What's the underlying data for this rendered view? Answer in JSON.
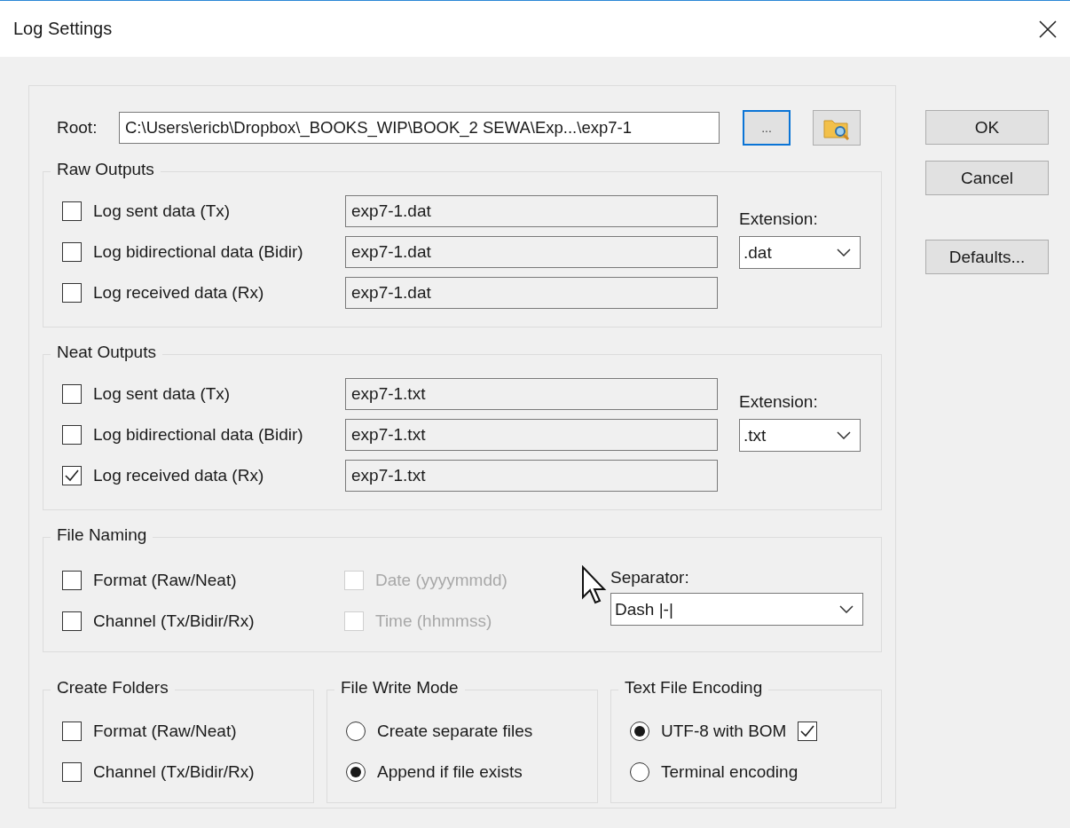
{
  "window": {
    "title": "Log Settings"
  },
  "root": {
    "label": "Root:",
    "value": "C:\\Users\\ericb\\Dropbox\\_BOOKS_WIP\\BOOK_2 SEWA\\Exp...\\exp7-1",
    "browse_button": "..."
  },
  "raw_outputs": {
    "title": "Raw Outputs",
    "extension_label": "Extension:",
    "extension": ".dat",
    "rows": [
      {
        "label": "Log sent data (Tx)",
        "checked": false,
        "value": "exp7-1.dat"
      },
      {
        "label": "Log bidirectional data (Bidir)",
        "checked": false,
        "value": "exp7-1.dat"
      },
      {
        "label": "Log received data (Rx)",
        "checked": false,
        "value": "exp7-1.dat"
      }
    ]
  },
  "neat_outputs": {
    "title": "Neat Outputs",
    "extension_label": "Extension:",
    "extension": ".txt",
    "rows": [
      {
        "label": "Log sent data (Tx)",
        "checked": false,
        "value": "exp7-1.txt"
      },
      {
        "label": "Log bidirectional data (Bidir)",
        "checked": false,
        "value": "exp7-1.txt"
      },
      {
        "label": "Log received data (Rx)",
        "checked": true,
        "value": "exp7-1.txt"
      }
    ]
  },
  "file_naming": {
    "title": "File Naming",
    "separator_label": "Separator:",
    "separator": "Dash |-|",
    "options": [
      {
        "label": "Format (Raw/Neat)",
        "checked": false,
        "disabled": false
      },
      {
        "label": "Channel (Tx/Bidir/Rx)",
        "checked": false,
        "disabled": false
      },
      {
        "label": "Date (yyyymmdd)",
        "checked": false,
        "disabled": true
      },
      {
        "label": "Time (hhmmss)",
        "checked": false,
        "disabled": true
      }
    ]
  },
  "create_folders": {
    "title": "Create Folders",
    "options": [
      {
        "label": "Format (Raw/Neat)",
        "checked": false
      },
      {
        "label": "Channel (Tx/Bidir/Rx)",
        "checked": false
      }
    ]
  },
  "file_write_mode": {
    "title": "File Write Mode",
    "options": [
      {
        "label": "Create separate files",
        "selected": false
      },
      {
        "label": "Append if file exists",
        "selected": true
      }
    ]
  },
  "text_file_encoding": {
    "title": "Text File Encoding",
    "bom_checked": true,
    "options": [
      {
        "label": "UTF-8 with BOM",
        "selected": true
      },
      {
        "label": "Terminal encoding",
        "selected": false
      }
    ]
  },
  "buttons": [
    {
      "label": "OK"
    },
    {
      "label": "Cancel"
    },
    {
      "label": "Defaults..."
    }
  ]
}
